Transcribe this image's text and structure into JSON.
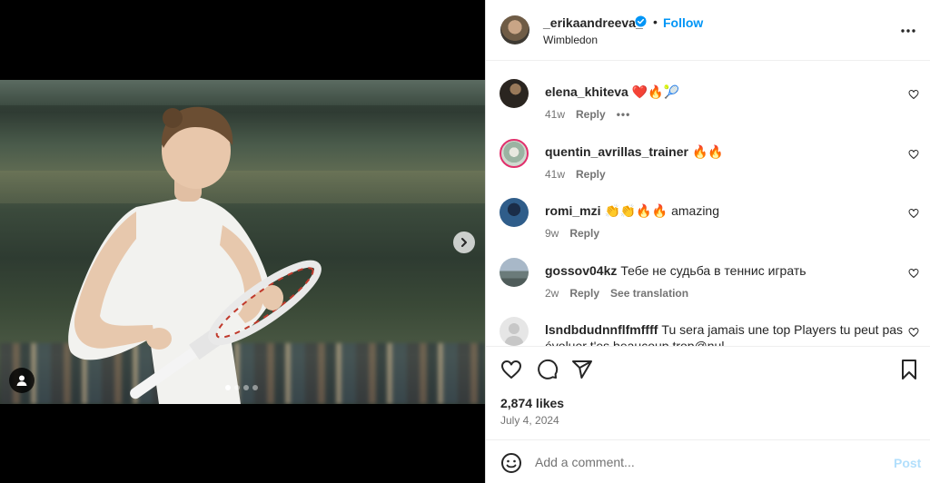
{
  "post": {
    "username": "_erikaandreeva_",
    "dot": "•",
    "follow_label": "Follow",
    "location": "Wimbledon",
    "carousel": {
      "count": 4,
      "active_index": 1
    }
  },
  "comments": [
    {
      "username": "elena_khiteva",
      "text": "❤️🔥🎾",
      "time": "41w",
      "reply": "Reply",
      "extra": "•••"
    },
    {
      "username": "quentin_avrillas_trainer",
      "text": "🔥🔥",
      "time": "41w",
      "reply": "Reply",
      "extra": ""
    },
    {
      "username": "romi_mzi",
      "text": "👏👏🔥🔥 amazing",
      "time": "9w",
      "reply": "Reply",
      "extra": ""
    },
    {
      "username": "gossov04kz",
      "text": "Тебе не судьба в теннис играть",
      "time": "2w",
      "reply": "Reply",
      "extra": "See translation"
    },
    {
      "username": "lsndbdudnnflfmffff",
      "text": "Tu sera jamais une top Players tu peut pas",
      "time": "",
      "reply": "",
      "extra": ""
    }
  ],
  "comment_overflow_line": "évoluer t'es beaucoup trop@nul",
  "likes": "2,874 likes",
  "date": "July 4, 2024",
  "composer": {
    "placeholder": "Add a comment...",
    "post_label": "Post"
  },
  "colors": {
    "accent": "#0095f6",
    "post_disabled": "#b2dffc",
    "muted": "#737373"
  },
  "icons": [
    "more-icon",
    "heart-icon",
    "comment-icon",
    "share-icon",
    "bookmark-icon",
    "emoji-icon",
    "chevron-right-icon",
    "user-tag-icon",
    "verified-icon"
  ]
}
